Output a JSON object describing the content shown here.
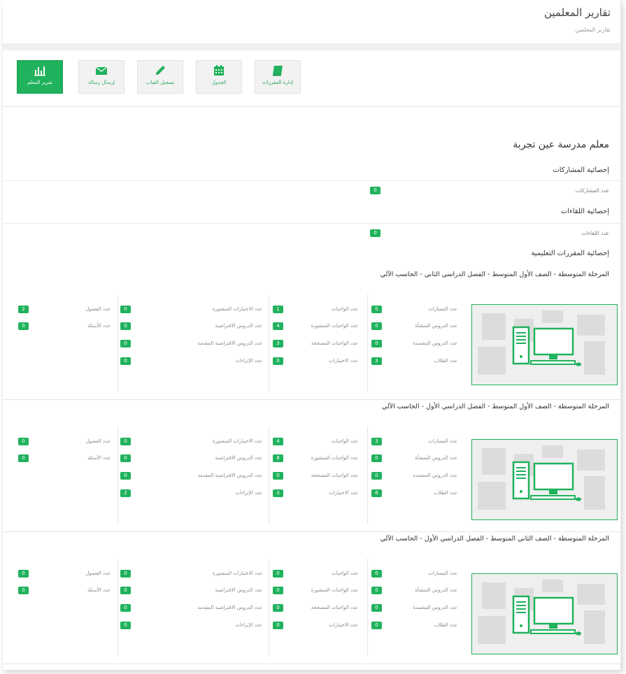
{
  "header": {
    "title": "تقارير المعلمين",
    "breadcrumb": "تقارير المعلمين"
  },
  "toolbar": [
    {
      "label": "إدارة المقررات",
      "icon": "book-icon"
    },
    {
      "label": "الجدول",
      "icon": "calendar-icon"
    },
    {
      "label": "تسجيل الغياب",
      "icon": "pencil-icon"
    },
    {
      "label": "إرسال رسالة",
      "icon": "envelope-icon"
    },
    {
      "label": "تقرير المعلم",
      "icon": "bar-chart-icon",
      "active": true
    }
  ],
  "teacher": {
    "name": "معلم مدرسة عين تجربة"
  },
  "sections": {
    "participations": {
      "title": "إحصائية المشاركات",
      "label": "عدد المشاركات",
      "value": "0"
    },
    "meetings": {
      "title": "إحصائية اللقاءات",
      "label": "عدد اللقاءات",
      "value": "0"
    },
    "courses_title": "إحصائية المقررات التعليمية"
  },
  "courses": [
    {
      "title": "المرحلة المتوسطة - الصف الأول المتوسط - الفصل الدراسي الثاني - الحاسب الآلي",
      "col1": [
        {
          "label": "عدد المسارات",
          "value": "0"
        },
        {
          "label": "عدد الدروس المنشأة",
          "value": "0"
        },
        {
          "label": "عدد الدروس المعتمدة",
          "value": "0"
        },
        {
          "label": "عدد الطلاب",
          "value": "3"
        }
      ],
      "col2": [
        {
          "label": "عدد الواجبات",
          "value": "1"
        },
        {
          "label": "عدد الواجبات المنشورة",
          "value": "4"
        },
        {
          "label": "عدد الواجبات المصححة",
          "value": "3"
        },
        {
          "label": "عدد الاختبارات",
          "value": "0"
        }
      ],
      "col3": [
        {
          "label": "عدد الاختبارات المنشورة",
          "value": "0"
        },
        {
          "label": "عدد الدروس الافتراضية",
          "value": "0"
        },
        {
          "label": "عدد الدروس الافتراضية المقدمة",
          "value": "0"
        },
        {
          "label": "عدد الإثراءات",
          "value": "0"
        }
      ],
      "col4": [
        {
          "label": "عدد الفصول",
          "value": "2"
        },
        {
          "label": "عدد الأسئلة",
          "value": "0"
        }
      ]
    },
    {
      "title": "المرحلة المتوسطة - الصف الأول المتوسط - الفصل الدراسي الأول - الحاسب الآلي",
      "col1": [
        {
          "label": "عدد المسارات",
          "value": "3"
        },
        {
          "label": "عدد الدروس المنشأة",
          "value": "0"
        },
        {
          "label": "عدد الدروس المعتمدة",
          "value": "0"
        },
        {
          "label": "عدد الطلاب",
          "value": "6"
        }
      ],
      "col2": [
        {
          "label": "عدد الواجبات",
          "value": "4"
        },
        {
          "label": "عدد الواجبات المنشورة",
          "value": "8"
        },
        {
          "label": "عدد الواجبات المصححة",
          "value": "0"
        },
        {
          "label": "عدد الاختبارات",
          "value": "3"
        }
      ],
      "col3": [
        {
          "label": "عدد الاختبارات المنشورة",
          "value": "0"
        },
        {
          "label": "عدد الدروس الافتراضية",
          "value": "0"
        },
        {
          "label": "عدد الدروس الافتراضية المقدمة",
          "value": "0"
        },
        {
          "label": "عدد الإثراءات",
          "value": "2"
        }
      ],
      "col4": [
        {
          "label": "عدد الفصول",
          "value": "0"
        },
        {
          "label": "عدد الأسئلة",
          "value": "0"
        }
      ]
    },
    {
      "title": "المرحلة المتوسطة - الصف الثاني المتوسط - الفصل الدراسي الأول - الحاسب الآلي",
      "col1": [
        {
          "label": "عدد المسارات",
          "value": "0"
        },
        {
          "label": "عدد الدروس المنشأة",
          "value": "0"
        },
        {
          "label": "عدد الدروس المعتمدة",
          "value": "0"
        },
        {
          "label": "عدد الطلاب",
          "value": "0"
        }
      ],
      "col2": [
        {
          "label": "عدد الواجبات",
          "value": "0"
        },
        {
          "label": "عدد الواجبات المنشورة",
          "value": "0"
        },
        {
          "label": "عدد الواجبات المصححة",
          "value": "0"
        },
        {
          "label": "عدد الاختبارات",
          "value": "0"
        }
      ],
      "col3": [
        {
          "label": "عدد الاختبارات المنشورة",
          "value": "0"
        },
        {
          "label": "عدد الدروس الافتراضية",
          "value": "0"
        },
        {
          "label": "عدد الدروس الافتراضية المقدمة",
          "value": "0"
        },
        {
          "label": "عدد الإثراءات",
          "value": "0"
        }
      ],
      "col4": [
        {
          "label": "عدد الفصول",
          "value": "0"
        },
        {
          "label": "عدد الأسئلة",
          "value": "0"
        }
      ]
    }
  ]
}
